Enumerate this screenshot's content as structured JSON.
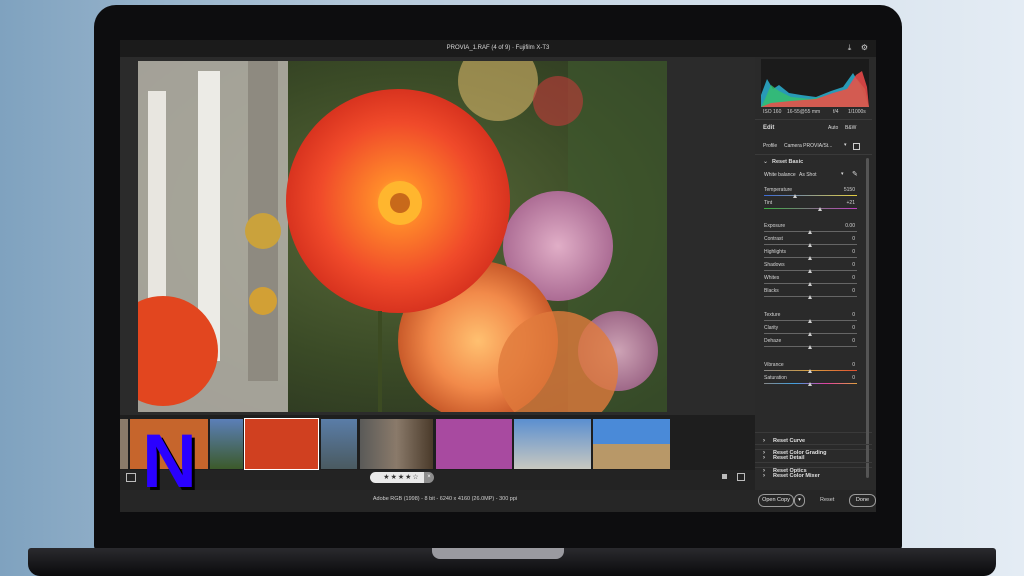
{
  "window": {
    "title": "PROVIA_1.RAF (4 of 9)  ·  Fujifilm X-T3"
  },
  "toolbar_icons": [
    "download-icon",
    "gear-icon"
  ],
  "photo_meta": {
    "iso": "ISO 160",
    "lens": "16-55@55 mm",
    "aperture": "f/4",
    "shutter": "1/1000s"
  },
  "panel": {
    "edit_label": "Edit",
    "auto_label": "Auto",
    "bw_label": "B&W",
    "profile_label": "Profile",
    "profile_value": "Camera PROVIA/St...",
    "basic_section": "Reset Basic",
    "white_balance_label": "White balance",
    "white_balance_value": "As Shot",
    "temperature": {
      "label": "Temperature",
      "value": "5150"
    },
    "tint": {
      "label": "Tint",
      "value": "+21"
    },
    "exposure": {
      "label": "Exposure",
      "value": "0.00"
    },
    "contrast": {
      "label": "Contrast",
      "value": "0"
    },
    "highlights": {
      "label": "Highlights",
      "value": "0"
    },
    "shadows": {
      "label": "Shadows",
      "value": "0"
    },
    "whites": {
      "label": "Whites",
      "value": "0"
    },
    "blacks": {
      "label": "Blacks",
      "value": "0"
    },
    "texture": {
      "label": "Texture",
      "value": "0"
    },
    "clarity": {
      "label": "Clarity",
      "value": "0"
    },
    "dehaze": {
      "label": "Dehaze",
      "value": "0"
    },
    "vibrance": {
      "label": "Vibrance",
      "value": "0"
    },
    "saturation": {
      "label": "Saturation",
      "value": "0"
    },
    "sections": [
      "Reset Curve",
      "Reset Detail",
      "Reset Color Mixer",
      "Reset Color Grading",
      "Reset Optics"
    ]
  },
  "rating": {
    "stars": "★★★★☆",
    "value": 4,
    "clear": "×"
  },
  "bottom": {
    "status": "Adobe RGB (1998) - 8 bit - 6240 x 4160 (26.0MP) - 300 ppi",
    "open_copy": "Open Copy",
    "reset": "Reset",
    "done": "Done"
  },
  "overlay": {
    "letter": "N"
  },
  "colors": {
    "accent": "#1f5fff",
    "overlay_letter": "#2a00ff"
  }
}
